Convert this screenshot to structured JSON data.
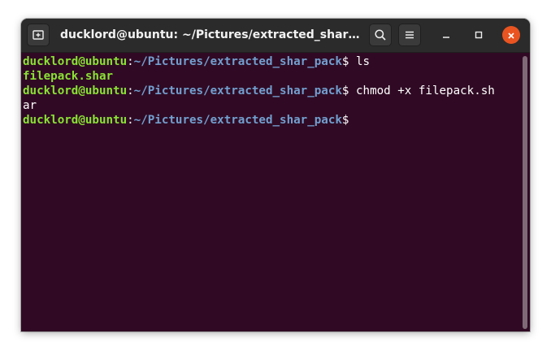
{
  "window": {
    "title": "ducklord@ubuntu: ~/Pictures/extracted_shar_p..."
  },
  "icons": {
    "new_tab": "new-tab-icon",
    "search": "search-icon",
    "menu": "hamburger-menu-icon",
    "minimize": "minimize-icon",
    "maximize": "maximize-icon",
    "close": "close-icon"
  },
  "colors": {
    "terminal_bg": "#300a24",
    "prompt_user": "#8ae234",
    "prompt_path": "#729fcf",
    "close_button": "#e95420"
  },
  "terminal": {
    "lines": [
      {
        "type": "prompt",
        "user": "ducklord@ubuntu",
        "colon": ":",
        "path": "~/Pictures/extracted_shar_pack",
        "dollar": "$",
        "command": " ls"
      },
      {
        "type": "output",
        "text": "filepack.shar"
      },
      {
        "type": "prompt",
        "user": "ducklord@ubuntu",
        "colon": ":",
        "path": "~/Pictures/extracted_shar_pack",
        "dollar": "$",
        "command": " chmod +x filepack.sh"
      },
      {
        "type": "output",
        "text": "ar"
      },
      {
        "type": "prompt",
        "user": "ducklord@ubuntu",
        "colon": ":",
        "path": "~/Pictures/extracted_shar_pack",
        "dollar": "$",
        "command": ""
      }
    ]
  }
}
